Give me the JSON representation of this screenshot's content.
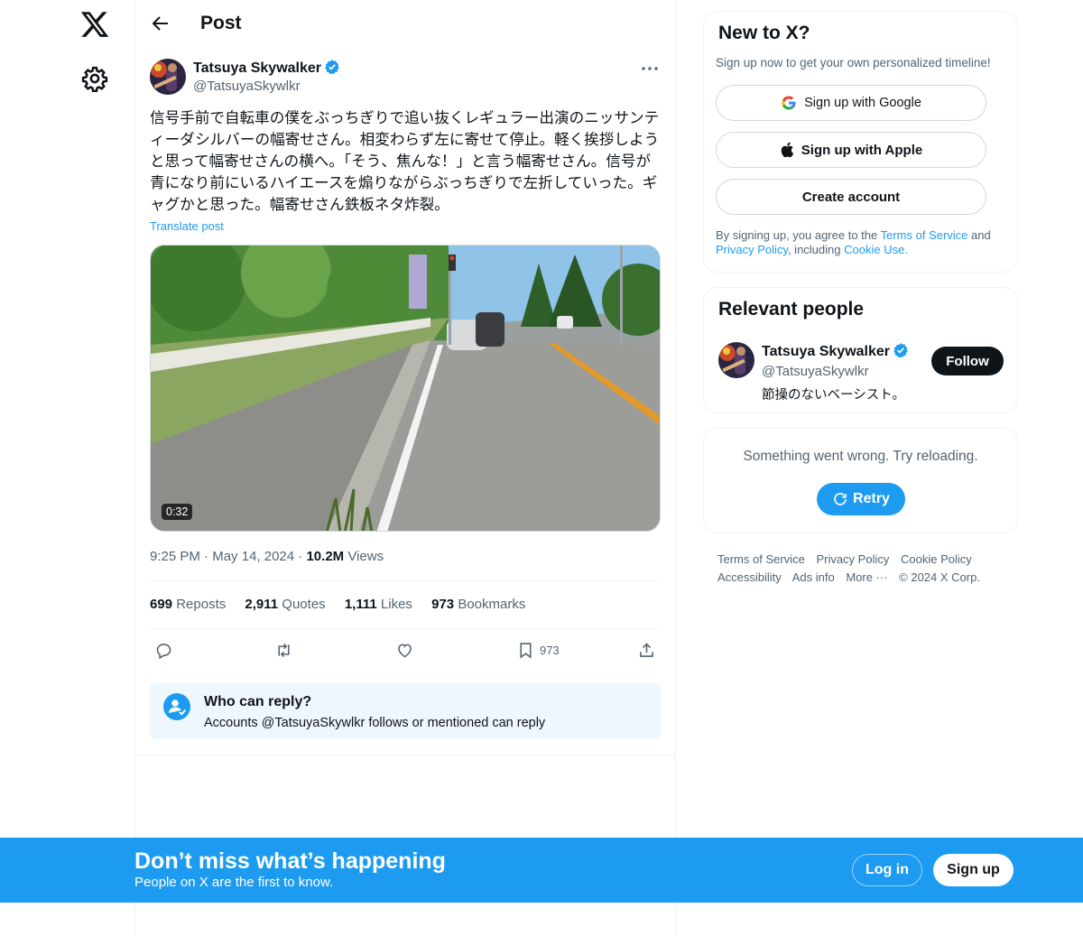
{
  "nav": {
    "logo": "x-logo-icon",
    "settings": "gear-icon"
  },
  "header": {
    "title": "Post",
    "back": "back-arrow-icon"
  },
  "post": {
    "author_name": "Tatsuya Skywalker",
    "author_handle": "@TatsuyaSkywlkr",
    "text": "信号手前で自転車の僕をぶっちぎりで追い抜くレギュラー出演のニッサンティーダシルバーの幅寄せさん。相変わらず左に寄せて停止。軽く挨拶しようと思って幅寄せさんの横へ。「そう、焦んな！」と言う幅寄せさん。信号が青になり前にいるハイエースを煽りながらぶっちぎりで左折していった。ギャグかと思った。幅寄せさん鉄板ネタ炸裂。",
    "translate": "Translate post",
    "video_duration": "0:32",
    "time": "9:25 PM",
    "date": "May 14, 2024",
    "views_count": "10.2M",
    "views_label": "Views",
    "stats": {
      "reposts_count": "699",
      "reposts_label": "Reposts",
      "quotes_count": "2,911",
      "quotes_label": "Quotes",
      "likes_count": "1,111",
      "likes_label": "Likes",
      "bookmarks_count": "973",
      "bookmarks_label": "Bookmarks"
    },
    "actions": {
      "bookmark_count": "973"
    },
    "reply": {
      "title": "Who can reply?",
      "desc": "Accounts @TatsuyaSkywlkr follows or mentioned can reply"
    }
  },
  "signup_card": {
    "title": "New to X?",
    "subtitle": "Sign up now to get your own personalized timeline!",
    "google": "Sign up with Google",
    "apple": "Sign up with Apple",
    "create": "Create account",
    "legal_1": "By signing up, you agree to the ",
    "terms": "Terms of Service",
    "legal_2": " and ",
    "privacy": "Privacy Policy",
    "legal_3": ", including ",
    "cookie": "Cookie Use."
  },
  "relevant": {
    "title": "Relevant people",
    "name": "Tatsuya Skywalker",
    "handle": "@TatsuyaSkywlkr",
    "bio": "節操のないベーシスト。",
    "follow": "Follow"
  },
  "error_card": {
    "message": "Something went wrong. Try reloading.",
    "retry": "Retry"
  },
  "footer": {
    "terms": "Terms of Service",
    "privacy": "Privacy Policy",
    "cookie": "Cookie Policy",
    "accessibility": "Accessibility",
    "ads": "Ads info",
    "more": "More ···",
    "copyright": "© 2024 X Corp."
  },
  "bottom_bar": {
    "title": "Don’t miss what’s happening",
    "subtitle": "People on X are the first to know.",
    "login": "Log in",
    "signup": "Sign up"
  },
  "colors": {
    "accent": "#1d9bf0",
    "text": "#0f1419",
    "muted": "#536471"
  }
}
